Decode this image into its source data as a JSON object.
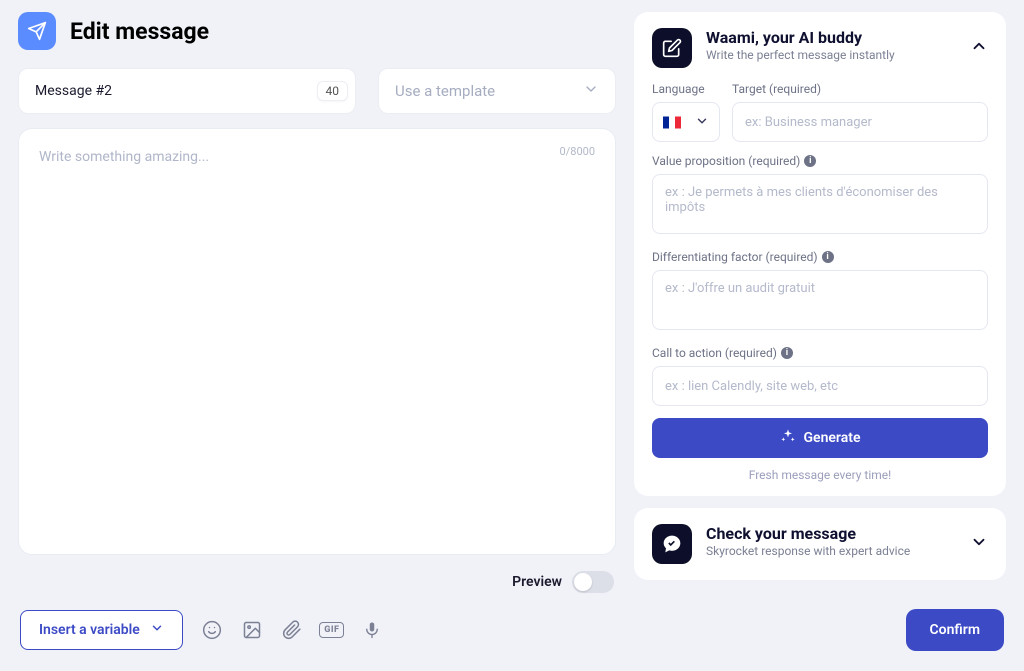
{
  "page": {
    "title": "Edit message"
  },
  "message": {
    "name": "Message #2",
    "limit": 40,
    "template_placeholder": "Use a template",
    "editor_placeholder": "Write something amazing...",
    "counter": "0/8000"
  },
  "ai_panel": {
    "title": "Waami, your AI buddy",
    "subtitle": "Write the perfect message instantly",
    "lang_label": "Language",
    "target_label": "Target (required)",
    "target_placeholder": "ex: Business manager",
    "value_label": "Value proposition (required)",
    "value_placeholder": "ex : Je permets à mes clients d'économiser des impôts",
    "diff_label": "Differentiating factor (required)",
    "diff_placeholder": "ex : J'offre un audit gratuit",
    "cta_label": "Call to action (required)",
    "cta_placeholder": "ex : lien Calendly, site web, etc",
    "generate_label": "Generate",
    "note": "Fresh message every time!"
  },
  "check_panel": {
    "title": "Check your message",
    "subtitle": "Skyrocket response with expert advice"
  },
  "preview": {
    "label": "Preview",
    "enabled": false
  },
  "actions": {
    "insert_variable": "Insert a variable",
    "confirm": "Confirm",
    "gif_label": "GIF"
  }
}
